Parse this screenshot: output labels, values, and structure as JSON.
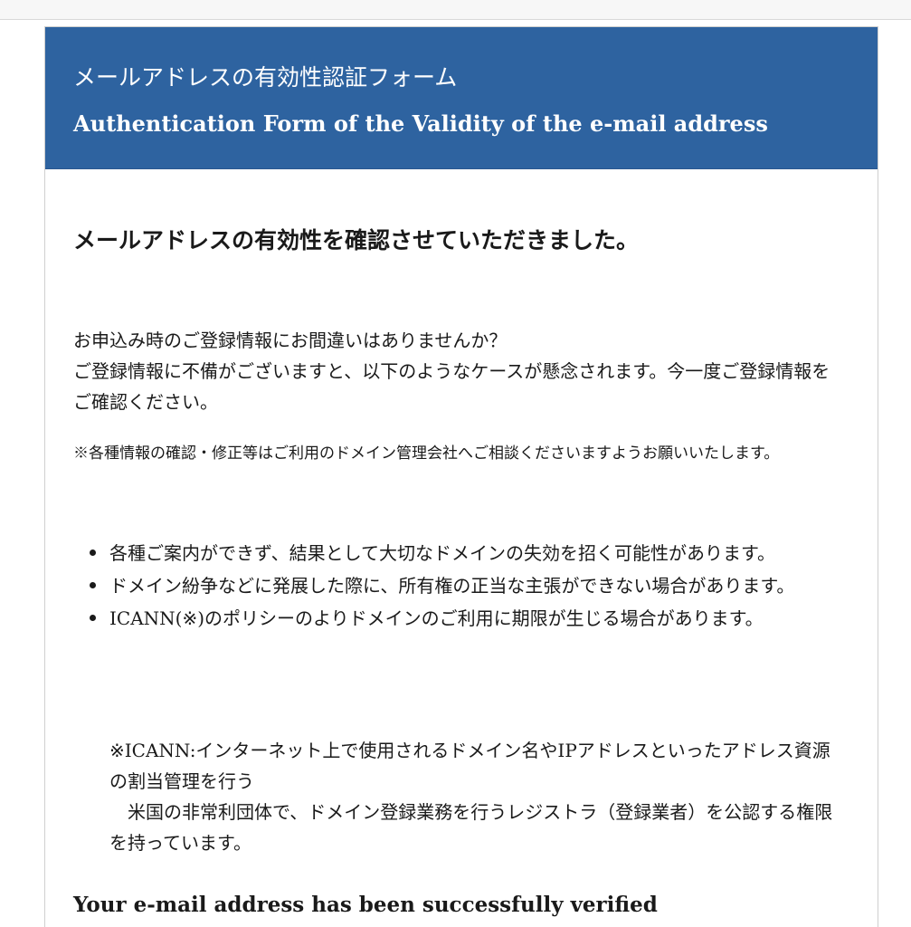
{
  "header": {
    "title_ja": "メールアドレスの有効性認証フォーム",
    "title_en": "Authentication Form of the Validity of the e-mail address"
  },
  "content": {
    "success_heading": "メールアドレスの有効性を確認させていただきました。",
    "question_line1": "お申込み時のご登録情報にお間違いはありませんか？",
    "question_line2": "ご登録情報に不備がございますと、以下のようなケースが懸念されます。今一度ご登録情報をご確認ください。",
    "notice": "※各種情報の確認・修正等はご利用のドメイン管理会社へご相談くださいますようお願いいたします。",
    "cases": [
      "各種ご案内ができず、結果として大切なドメインの失効を招く可能性があります。",
      "ドメイン紛争などに発展した際に、所有権の正当な主張ができない場合があります。",
      "ICANN(※)のポリシーのよりドメインのご利用に期限が生じる場合があります。"
    ],
    "icann_note_line1": "※ICANN:インターネット上で使用されるドメイン名やIPアドレスといったアドレス資源の割当管理を行う",
    "icann_note_line2": "　米国の非常利団体で、ドメイン登録業務を行うレジストラ（登録業者）を公認する権限を持っています。",
    "verified_en": "Your e-mail address has been successfully verified"
  },
  "colors": {
    "header_background": "#2e63a0",
    "header_text": "#ffffff",
    "body_text": "#1a1a1a"
  }
}
